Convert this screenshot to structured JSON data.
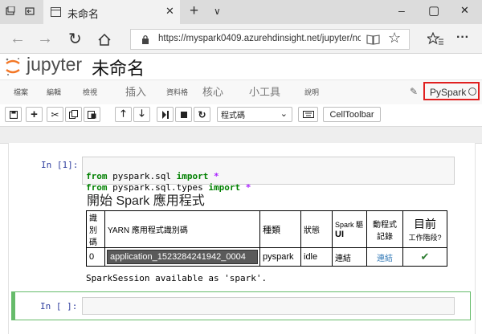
{
  "browser": {
    "tab_title": "未命名",
    "new_tab": "+",
    "tab_dropdown": "∨",
    "window_controls": [
      "–",
      "▢",
      "✕"
    ],
    "url": "https://myspark0409.azurehdinsight.net/jupyter/no",
    "more": "···"
  },
  "jupyter": {
    "logo_text": "jupyter",
    "notebook_name": "未命名",
    "menu": [
      "檔案",
      "編輯",
      "檢視",
      "插入",
      "資料格",
      "核心",
      "小工具",
      "說明"
    ],
    "kernel_name": "PySpark",
    "cell_type": "程式碼",
    "celltoolbar_label": "CellToolbar"
  },
  "cells": {
    "cell1_prompt": "In [1]:",
    "code_line1": {
      "kw1": "from",
      "mod": " pyspark.sql ",
      "kw2": "import",
      "star": " *"
    },
    "code_line2": {
      "kw1": "from",
      "mod": " pyspark.sql.types ",
      "kw2": "import",
      "star": " *"
    },
    "output_heading": "開始 Spark 應用程式",
    "table_headers": {
      "id": "識別碼",
      "yarn": "YARN 應用程式識別碼",
      "kind": "種類",
      "state": "狀態",
      "spark_ui_top": "Spark 驅",
      "spark_ui_bottom": "UI",
      "driver_log_top": "動程式",
      "driver_log_bottom": "記錄",
      "current_top": "目前",
      "current_bottom": "工作階段?"
    },
    "table_row": {
      "id": "0",
      "app_id": "application_1523284241942_0004",
      "kind": "pyspark",
      "state": "idle",
      "spark_ui": "連結",
      "driver_log": "連結",
      "current": "✔"
    },
    "session_text": "SparkSession available as 'spark'.",
    "cell2_prompt": "In [ ]:"
  },
  "colors": {
    "kernel_highlight": "#e02020",
    "active_cell_border": "#66bb6a",
    "check": "#2e7d32"
  }
}
